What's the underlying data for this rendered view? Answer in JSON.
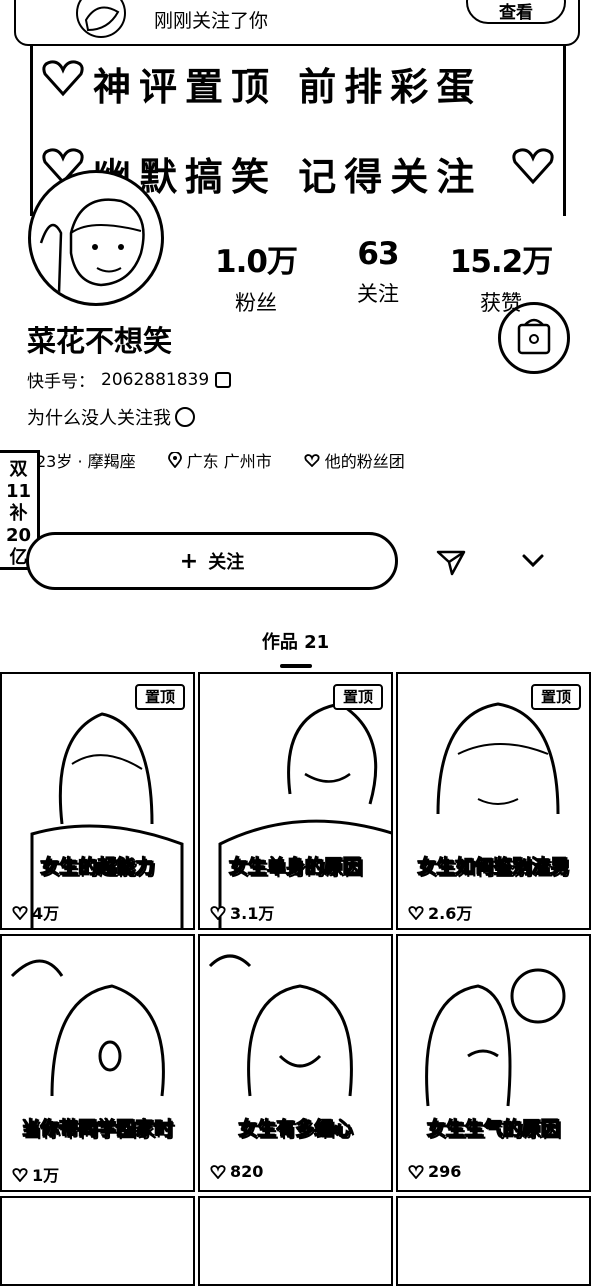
{
  "notification": {
    "text": "刚刚关注了你",
    "button_label": "查看"
  },
  "banner": {
    "line1": "神评置顶 前排彩蛋",
    "line2": "幽默搞笑 记得关注"
  },
  "profile": {
    "name": "菜花不想笑",
    "kuaishou_id_label": "快手号：",
    "kuaishou_id": "2062881839",
    "bio": "为什么没人关注我",
    "stats": [
      {
        "value": "1.0万",
        "label": "粉丝"
      },
      {
        "value": "63",
        "label": "关注"
      },
      {
        "value": "15.2万",
        "label": "获赞"
      }
    ],
    "tags": {
      "age_zodiac": "23岁 · 摩羯座",
      "location": "广东 广州市",
      "fan_group": "他的粉丝团"
    },
    "side_label": "双11补20亿"
  },
  "actions": {
    "follow_label": "关注"
  },
  "works": {
    "tab_label": "作品 21",
    "pin_label": "置顶",
    "items": [
      {
        "title": "女生的超能力",
        "likes": "4万",
        "pinned": true
      },
      {
        "title": "女生单身的原因",
        "likes": "3.1万",
        "pinned": true
      },
      {
        "title": "女生如何鉴别渣男",
        "likes": "2.6万",
        "pinned": true
      },
      {
        "title": "当你带同学回家时",
        "likes": "1万",
        "pinned": false
      },
      {
        "title": "女生有多细心",
        "likes": "820",
        "pinned": false
      },
      {
        "title": "女生生气的原因",
        "likes": "296",
        "pinned": false
      }
    ]
  },
  "colors": {
    "background": "#ffffff",
    "ink": "#000000"
  }
}
